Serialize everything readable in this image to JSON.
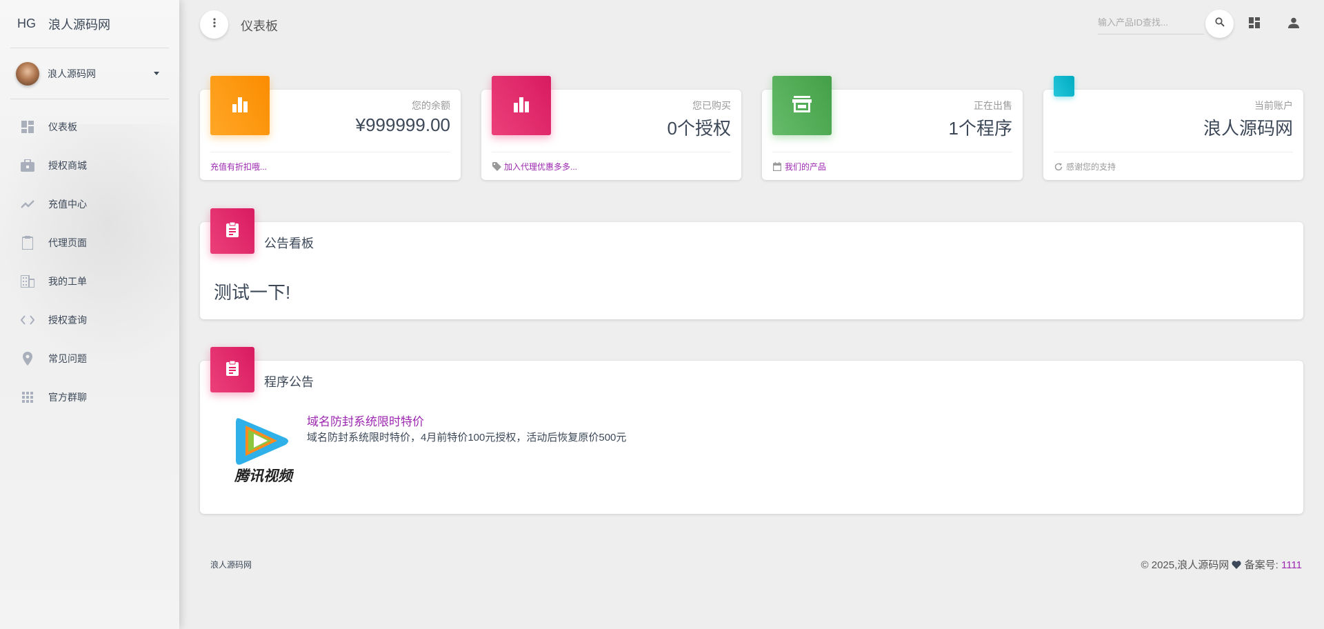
{
  "brand": {
    "mini": "HG",
    "name": "浪人源码网"
  },
  "user": {
    "name": "浪人源码网"
  },
  "sidebar": {
    "items": [
      {
        "label": "仪表板",
        "icon": "dashboard-icon"
      },
      {
        "label": "授权商城",
        "icon": "briefcase-icon"
      },
      {
        "label": "充值中心",
        "icon": "trending-icon"
      },
      {
        "label": "代理页面",
        "icon": "clipboard-icon"
      },
      {
        "label": "我的工单",
        "icon": "building-icon"
      },
      {
        "label": "授权查询",
        "icon": "code-icon"
      },
      {
        "label": "常见问题",
        "icon": "location-pin-icon"
      },
      {
        "label": "官方群聊",
        "icon": "apps-grid-icon"
      }
    ]
  },
  "topbar": {
    "title": "仪表板",
    "search_placeholder": "输入产品ID查找..."
  },
  "stats": [
    {
      "category": "您的余额",
      "value": "¥999999.00",
      "footer": "充值有折扣哦...",
      "color": "#ff9800",
      "icon": "bar-chart-icon"
    },
    {
      "category": "您已购买",
      "value": "0个授权",
      "footer": "加入代理优惠多多...",
      "color": "#e91e63",
      "icon": "bar-chart-icon"
    },
    {
      "category": "正在出售",
      "value": "1个程序",
      "footer": "我们的产品",
      "color": "#4caf50",
      "icon": "store-icon"
    },
    {
      "category": "当前账户",
      "value": "浪人源码网",
      "footer": "感谢您的支持",
      "color": "#00bcd4",
      "icon": "account-icon"
    }
  ],
  "announcement": {
    "title": "公告看板",
    "body": "测试一下!"
  },
  "program": {
    "title": "程序公告",
    "item_name": "域名防封系统限时特价",
    "item_desc": "域名防封系统限时特价，4月前特价100元授权，活动后恢复原价500元",
    "logo_text": "腾讯视频"
  },
  "footer": {
    "left": "浪人源码网",
    "right_prefix": "© 2025,浪人源码网",
    "record_label": "备案号:",
    "record_value": "1111"
  }
}
